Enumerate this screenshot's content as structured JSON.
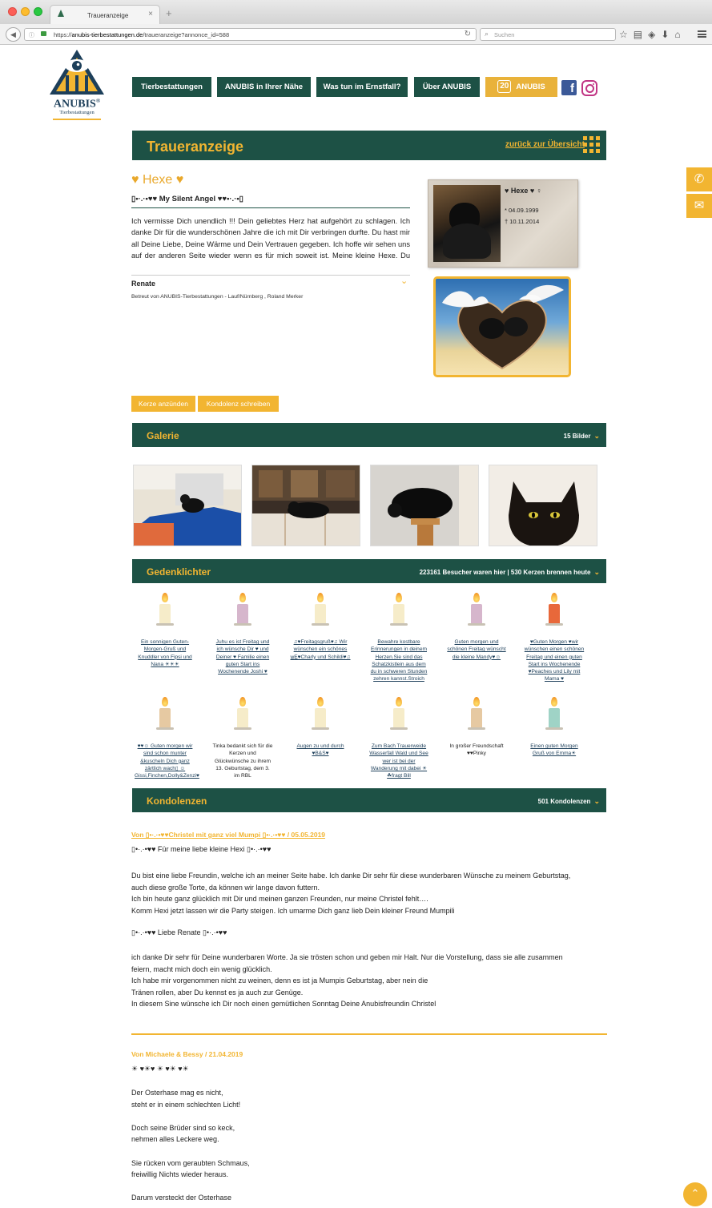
{
  "browser": {
    "tab_title": "Traueranzeige",
    "tab_close": "×",
    "new_tab": "+",
    "url_prefix": "https://",
    "url_domain": "anubis-tierbestattungen.de",
    "url_path": "/traueranzeige?annonce_id=588",
    "search_placeholder": "Suchen"
  },
  "logo": {
    "name": "ANUBIS",
    "registered": "®",
    "subtitle": "Tierbestattungen"
  },
  "nav": {
    "items": [
      "Tierbestattungen",
      "ANUBIS in Ihrer Nähe",
      "Was tun im Ernstfall?",
      "Über ANUBIS"
    ],
    "jubilee_number": "20",
    "jubilee_label": "ANUBIS"
  },
  "header": {
    "title": "Traueranzeige",
    "back_link": "zurück zur Übersicht"
  },
  "pet": {
    "name": "♥ Hexe ♥",
    "subtitle": "▯•·.·•♥♥ My Silent Angel ♥♥•·.·•▯",
    "text": "Ich vermisse Dich unendlich !!! Dein geliebtes Herz hat aufgehört zu schlagen. Ich danke Dir für die wunderschönen Jahre die ich mit Dir verbringen durfte. Du hast mir all Deine Liebe, Deine Wärme und Dein Vertrauen gegeben. Ich hoffe wir sehen uns auf der anderen Seite wieder wenn es für mich soweit ist. Meine kleine Hexe. Du bist immer in meinem Herzen.",
    "owner": "Renate",
    "betreut": "Betreut von ANUBIS-Tierbestattungen - Lauf/Nürnberg , Roland Merker",
    "card_name": "♥ Hexe ♥ ♀",
    "born": "* 04.09.1999",
    "died": "† 10.11.2014"
  },
  "actions": {
    "candle": "Kerze anzünden",
    "condolence": "Kondolenz schreiben"
  },
  "gallery": {
    "title": "Galerie",
    "count": "15 Bilder"
  },
  "candles": {
    "title": "Gedenklichter",
    "stats": "223161 Besucher waren hier | 530 Kerzen brennen heute",
    "items": [
      {
        "msg": "Ein sonnigen Guten-Morgen-Gruß und Knuddler von Fipsi und Nana ☀☀☀",
        "wax": "#f6ecc9"
      },
      {
        "msg": "Juhu es ist Freitag und ich wünsche Dir ♥ und Deiner ♥ Familie einen guten Start ins Wochenende Joshi ♥",
        "wax": "#d6b6cc"
      },
      {
        "msg": "♫♥Freitagsgruß♥♫ Wir wünschen ein schönes w̲E̲♥Charly und Schildi♥♫",
        "wax": "#f6ecc9"
      },
      {
        "msg": "Bewahre kostbare Erinnerungen in deinem Herzen.Sie sind das Schatzkistlein aus dem du in schweren Stunden zehren kannst.Stroich",
        "wax": "#f6ecc9"
      },
      {
        "msg": "Guten morgen und schönen Freitag wünscht die kleine Mandy♥☺",
        "wax": "#d6b6cc"
      },
      {
        "msg": "♥Guten Morgen ♥wir wünschen einen schönen Freitag und einen guten Start ins Wochenende ♥Peaches und Lily mit Mama ♥",
        "wax": "#e8683a"
      },
      {
        "msg": "♥♥☺ Guten morgen wir sind schon munter &kuscheln Dich ganz zärtlich wach▯ ☺Gissi,Finchen,Dolly&Zenzi♥",
        "wax": "#e6c9a2"
      },
      {
        "msg": "Tinka bedankt sich für die Kerzen und Glückwünsche zu ihrem 13. Geburtstag, dem 3. im RBL",
        "wax": "#f6ecc9",
        "plain": true
      },
      {
        "msg": "Augen zu und durch ♥B&S♥",
        "wax": "#f6ecc9"
      },
      {
        "msg": "Zum Bach Trauerweide Wasserfall Wald und See wer ist bei der Wanderung mit dabei ☀☘fragt Bill",
        "wax": "#f6ecc9"
      },
      {
        "msg": "In großer Freundschaft ♥♥Pinky",
        "wax": "#e6c9a2",
        "plain": true
      },
      {
        "msg": "Einen guten Morgen Gruß von Emma☀",
        "wax": "#9fd3c6"
      }
    ]
  },
  "condolences": {
    "title": "Kondolenzen",
    "count": "501 Kondolenzen",
    "entry1": {
      "head": "Von ▯•·.·•♥♥Christel mit ganz viel Mumpi ▯•·.·•♥♥ / 05.05.2019",
      "greeting": "▯•·.·•♥♥ Für meine liebe kleine Hexi ▯•·.·•♥♥",
      "lines": [
        "Du bist eine liebe Freundin, welche ich an meiner Seite habe. Ich danke Dir sehr für diese wunderbaren Wünsche zu meinem Geburtstag,",
        "auch diese große Torte, da können wir lange davon futtern.",
        "Ich bin heute ganz glücklich mit Dir und meinen ganzen Freunden, nur meine Christel fehlt….",
        "Komm Hexi jetzt lassen wir die Party steigen. Ich umarme Dich ganz lieb Dein kleiner Freund Mumpili"
      ],
      "greeting2": "▯•·.·•♥♥ Liebe Renate ▯•·.·•♥♥",
      "lines2": [
        "ich danke Dir sehr für Deine wunderbaren Worte. Ja sie trösten schon und geben mir Halt. Nur die Vorstellung, dass sie alle zusammen",
        "feiern, macht mich doch ein wenig glücklich.",
        "Ich habe mir vorgenommen nicht zu weinen, denn es ist ja Mumpis Geburtstag, aber nein die",
        "Tränen rollen, aber Du kennst es ja auch zur Genüge.",
        "In diesem Sine wünsche ich Dir noch einen gemütlichen Sonntag Deine Anubisfreundin Christel"
      ]
    },
    "entry2": {
      "head": "Von Michaele & Bessy / 21.04.2019",
      "greeting": "☀ ♥☀♥ ☀ ♥☀ ♥☀",
      "lines": [
        "Der Osterhase mag es nicht,",
        "steht er in einem schlechten Licht!",
        "",
        "Doch seine Brüder sind so keck,",
        "nehmen alles Leckere weg.",
        "",
        "Sie rücken vom geraubten Schmaus,",
        "freiwillig Nichts wieder heraus.",
        "",
        "Darum versteckt der Osterhase"
      ]
    }
  },
  "colors": {
    "green": "#1d5145",
    "gold": "#f2b531"
  }
}
